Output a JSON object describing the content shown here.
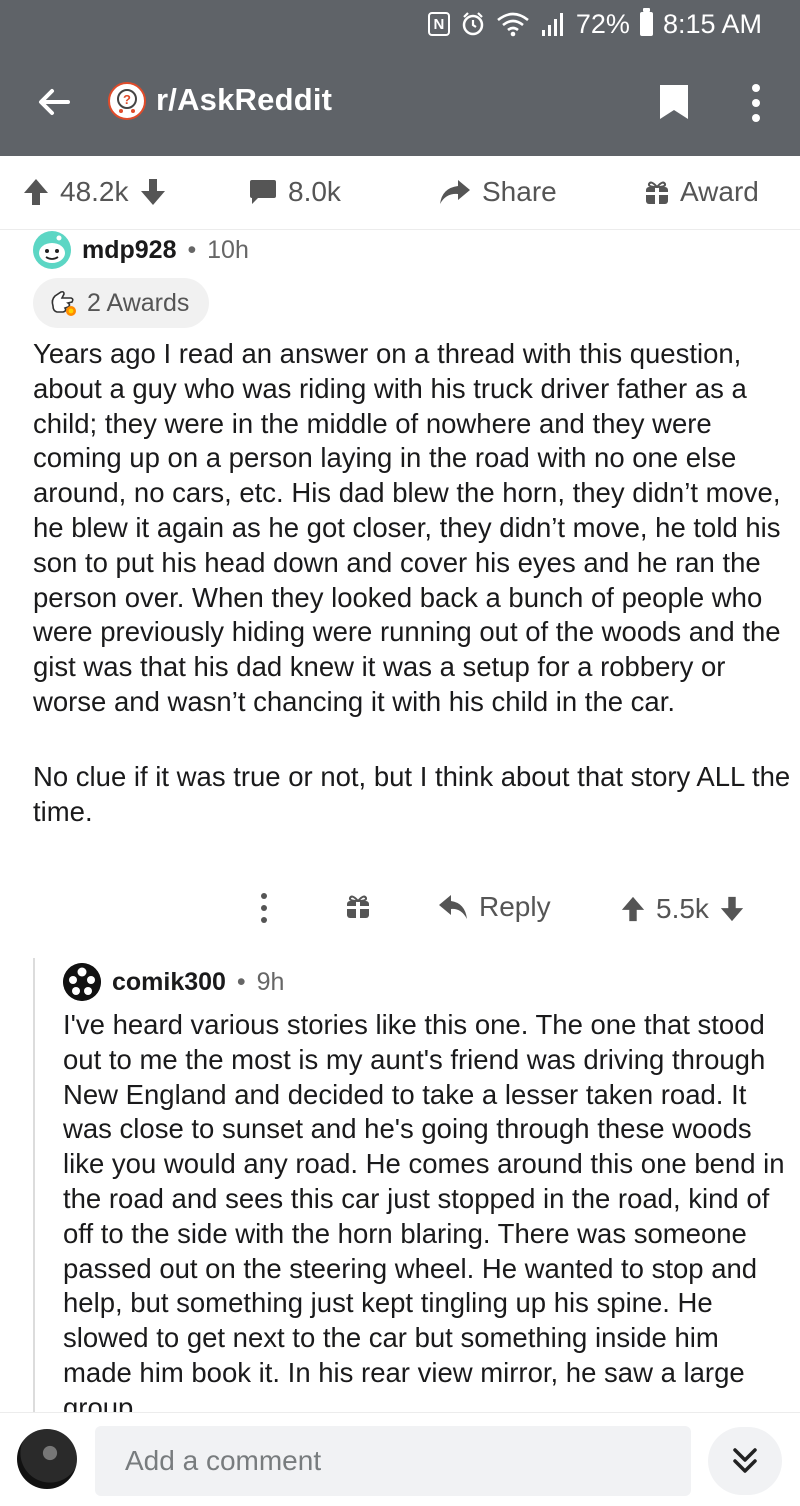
{
  "status_bar": {
    "battery": "72%",
    "time": "8:15 AM",
    "icons": [
      "nfc-icon",
      "alarm-icon",
      "wifi-icon",
      "signal-icon",
      "battery-icon"
    ]
  },
  "header": {
    "subreddit": "r/AskReddit",
    "icons": [
      "back-arrow-icon",
      "subreddit-avatar-icon",
      "bookmark-icon",
      "more-vertical-icon"
    ]
  },
  "post_actions": {
    "votes": "48.2k",
    "comments": "8.0k",
    "share_label": "Share",
    "award_label": "Award"
  },
  "comment": {
    "author": "mdp928",
    "separator": "•",
    "age": "10h",
    "awards": "2 Awards",
    "paragraphs": [
      "Years ago I read an answer on a thread with this question, about a guy who was riding with his truck driver father as a child; they were in the middle of nowhere and they were coming up on a person laying in the road with no one else around, no cars, etc. His dad blew the horn, they didn’t move, he blew it again as he got closer, they didn’t move, he told his son to put his head down and cover his eyes and he ran the person over. When they looked back a bunch of people who were previously hiding were running out of the woods and the gist was that his dad knew it was a setup for a robbery or worse and wasn’t chancing it with his child in the car.",
      "No clue if it was true or not, but I think about that story ALL the time."
    ],
    "reply_label": "Reply",
    "votes": "5.5k"
  },
  "reply": {
    "author": "comik300",
    "separator": "•",
    "age": "9h",
    "text": "I've heard various stories like this one. The one that stood out to me the most is my aunt's friend was driving through New England and decided to take a lesser taken road. It was close to sunset and he's going through these woods like you would any road. He comes around this one bend in the road and sees this car just stopped in the road, kind of off to the side with the horn blaring. There was someone passed out on the steering wheel. He wanted to stop and help, but something just kept tingling up his spine. He slowed to get next to the car but something inside him made him book it. In his rear view mirror, he saw a large group"
  },
  "bottom_bar": {
    "placeholder": "Add a comment"
  },
  "colors": {
    "app_bar": "#5f6368",
    "text": "#1a1a1b",
    "muted": "#555555",
    "input_bg": "#f1f2f4"
  }
}
